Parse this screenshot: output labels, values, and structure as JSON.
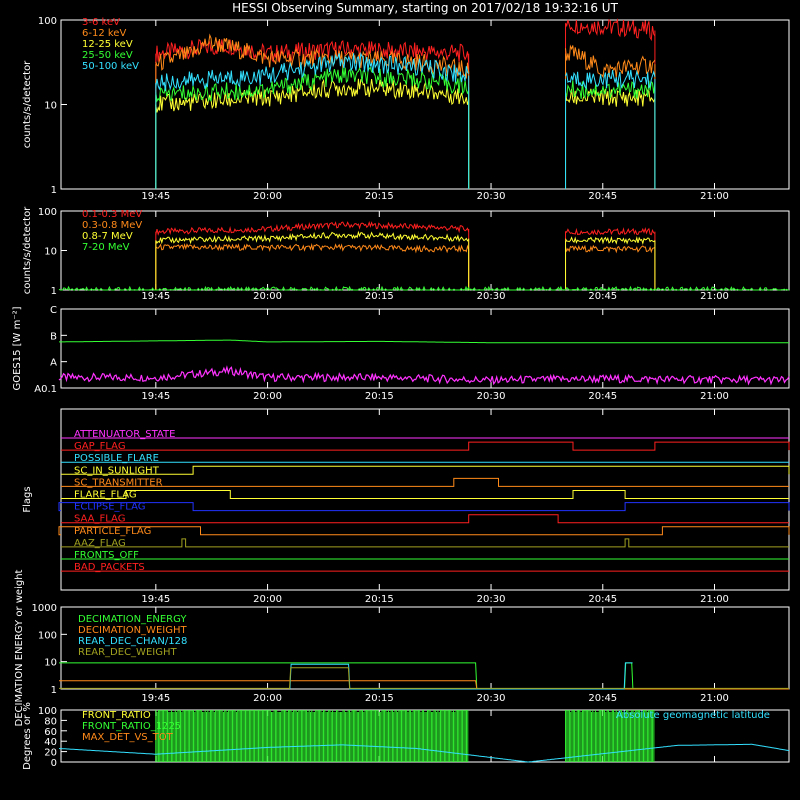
{
  "title": "HESSI Observing Summary, starting on 2017/02/18 19:32:16 UT",
  "time_ticks": [
    "19:45",
    "20:00",
    "20:15",
    "20:30",
    "20:45",
    "21:00"
  ],
  "colors": {
    "red": "#ff2020",
    "orange": "#ff8a1a",
    "yellow": "#ffff33",
    "green": "#33ff33",
    "cyan": "#33e0ff",
    "magenta": "#ff33ff",
    "blue": "#2233ff",
    "white": "#ffffff",
    "olive": "#a0a020",
    "lightgreen": "#aaff77"
  },
  "chart_data": [
    {
      "type": "line",
      "panel": "lightcurve",
      "ylabel": "counts/s/detector",
      "yscale": "log",
      "ylim": [
        1,
        100
      ],
      "ytick_labels": [
        "1",
        "10",
        "100"
      ],
      "legend_position": "top-left",
      "series": [
        {
          "name": "3-6 keV",
          "color": "red",
          "segments": [
            {
              "x": [
                "19:45",
                "19:50",
                "19:55",
                "20:00",
                "20:10",
                "20:20",
                "20:27"
              ],
              "y": [
                40,
                45,
                50,
                40,
                45,
                42,
                40
              ]
            },
            {
              "x": [
                "20:40",
                "20:45",
                "20:48",
                "20:52"
              ],
              "y": [
                90,
                85,
                80,
                75
              ]
            }
          ]
        },
        {
          "name": "6-12 keV",
          "color": "orange",
          "segments": [
            {
              "x": [
                "19:45",
                "19:50",
                "19:52",
                "20:00",
                "20:10",
                "20:20",
                "20:27"
              ],
              "y": [
                30,
                40,
                55,
                35,
                35,
                32,
                25
              ]
            },
            {
              "x": [
                "20:40",
                "20:41",
                "20:45",
                "20:52"
              ],
              "y": [
                40,
                40,
                25,
                30
              ]
            }
          ]
        },
        {
          "name": "12-25 keV",
          "color": "yellow",
          "segments": [
            {
              "x": [
                "19:45",
                "20:00",
                "20:10",
                "20:20",
                "20:27"
              ],
              "y": [
                10,
                12,
                16,
                15,
                12
              ]
            },
            {
              "x": [
                "20:40",
                "20:52"
              ],
              "y": [
                12,
                12
              ]
            }
          ]
        },
        {
          "name": "25-50 keV",
          "color": "green",
          "segments": [
            {
              "x": [
                "19:45",
                "20:00",
                "20:10",
                "20:20",
                "20:27"
              ],
              "y": [
                13,
                15,
                22,
                20,
                16
              ]
            },
            {
              "x": [
                "20:40",
                "20:52"
              ],
              "y": [
                15,
                15
              ]
            }
          ]
        },
        {
          "name": "50-100 keV",
          "color": "cyan",
          "segments": [
            {
              "x": [
                "19:45",
                "20:00",
                "20:10",
                "20:20",
                "20:27"
              ],
              "y": [
                18,
                22,
                32,
                28,
                22
              ]
            },
            {
              "x": [
                "20:40",
                "20:52"
              ],
              "y": [
                20,
                20
              ]
            }
          ]
        }
      ]
    },
    {
      "type": "line",
      "panel": "lightcurve-high",
      "ylabel": "counts/s/detector",
      "yscale": "log",
      "ylim": [
        1,
        100
      ],
      "ytick_labels": [
        "1",
        "10",
        "100"
      ],
      "legend_position": "top-left",
      "series": [
        {
          "name": "0.1-0.3 MeV",
          "color": "red",
          "segments": [
            {
              "x": [
                "19:45",
                "20:00",
                "20:10",
                "20:20",
                "20:27"
              ],
              "y": [
                30,
                35,
                45,
                40,
                35
              ]
            },
            {
              "x": [
                "20:40",
                "20:52"
              ],
              "y": [
                30,
                30
              ]
            }
          ]
        },
        {
          "name": "0.3-0.8 MeV",
          "color": "orange",
          "segments": [
            {
              "x": [
                "19:45",
                "20:00",
                "20:10",
                "20:20",
                "20:27"
              ],
              "y": [
                12,
                12,
                12,
                11,
                11
              ]
            },
            {
              "x": [
                "20:40",
                "20:52"
              ],
              "y": [
                11,
                11
              ]
            }
          ]
        },
        {
          "name": "0.8-7 MeV",
          "color": "yellow",
          "segments": [
            {
              "x": [
                "19:45",
                "20:00",
                "20:10",
                "20:20",
                "20:27"
              ],
              "y": [
                18,
                20,
                25,
                22,
                20
              ]
            },
            {
              "x": [
                "20:40",
                "20:52"
              ],
              "y": [
                18,
                18
              ]
            }
          ]
        },
        {
          "name": "7-20 MeV",
          "color": "green",
          "segments": [
            {
              "x": [
                "19:32",
                "21:10"
              ],
              "y": [
                1,
                1
              ]
            }
          ]
        }
      ]
    },
    {
      "type": "line",
      "panel": "goes",
      "ylabel": "GOES15 [W m⁻²]",
      "ytick_labels": [
        "A0.1",
        "A",
        "B",
        "C"
      ],
      "ylevels": [
        0,
        1,
        2,
        3
      ],
      "series": [
        {
          "color": "green",
          "segments": [
            {
              "x": [
                "19:32",
                "19:55",
                "20:00",
                "20:15",
                "20:30",
                "20:45",
                "21:10"
              ],
              "y": [
                1.75,
                1.82,
                1.75,
                1.77,
                1.72,
                1.72,
                1.72
              ]
            }
          ]
        },
        {
          "color": "magenta",
          "segments": [
            {
              "x": [
                "19:32",
                "19:45",
                "19:55",
                "20:00",
                "20:15",
                "20:30",
                "20:45",
                "21:10"
              ],
              "y": [
                0.4,
                0.4,
                0.65,
                0.4,
                0.4,
                0.3,
                0.35,
                0.3
              ]
            }
          ]
        }
      ]
    },
    {
      "type": "line",
      "panel": "flags",
      "ylabel": "Flags",
      "flags": [
        {
          "name": "ATTENUATOR_STATE",
          "color": "magenta",
          "highs": []
        },
        {
          "name": "GAP_FLAG",
          "color": "red",
          "highs": [
            [
              "20:27",
              "20:41"
            ],
            [
              "20:52",
              "21:10"
            ]
          ]
        },
        {
          "name": "POSSIBLE_FLARE",
          "color": "cyan",
          "highs": []
        },
        {
          "name": "SC_IN_SUNLIGHT",
          "color": "yellow",
          "highs": [
            [
              "19:50",
              "21:10"
            ]
          ]
        },
        {
          "name": "SC_TRANSMITTER",
          "color": "orange",
          "highs": [
            [
              "20:25",
              "20:31"
            ]
          ]
        },
        {
          "name": "FLARE_FLAG",
          "color": "yellow",
          "highs": [
            [
              "19:41",
              "19:55"
            ],
            [
              "20:41",
              "20:48"
            ]
          ]
        },
        {
          "name": "ECLIPSE_FLAG",
          "color": "blue",
          "highs": [
            [
              "19:32",
              "19:50"
            ],
            [
              "20:48",
              "21:10"
            ]
          ]
        },
        {
          "name": "SAA_FLAG",
          "color": "red",
          "highs": [
            [
              "20:27",
              "20:39"
            ]
          ]
        },
        {
          "name": "PARTICLE_FLAG",
          "color": "orange",
          "highs": [
            [
              "19:32",
              "19:51"
            ],
            [
              "20:53",
              "21:10"
            ]
          ]
        },
        {
          "name": "AAZ_FLAG",
          "color": "olive",
          "highs": [
            [
              "19:48.5",
              "19:49"
            ],
            [
              "20:48",
              "20:48.5"
            ]
          ]
        },
        {
          "name": "FRONTS_OFF",
          "color": "green",
          "highs": []
        },
        {
          "name": "BAD_PACKETS",
          "color": "red",
          "highs": []
        }
      ]
    },
    {
      "type": "line",
      "panel": "decimation",
      "ylabel": "DECIMATION ENERGY or weight",
      "yscale": "log",
      "ylim": [
        1,
        1000
      ],
      "ytick_labels": [
        "1",
        "10",
        "100",
        "1000"
      ],
      "series": [
        {
          "name": "DECIMATION_ENERGY",
          "color": "green",
          "segments": [
            {
              "x": [
                "19:32",
                "20:28",
                "20:28",
                "20:48",
                "20:48",
                "20:49",
                "20:49",
                "21:10"
              ],
              "y": [
                9,
                9,
                1,
                1,
                9,
                9,
                1,
                1
              ]
            }
          ]
        },
        {
          "name": "DECIMATION_WEIGHT",
          "color": "orange",
          "segments": [
            {
              "x": [
                "19:32",
                "20:28",
                "20:28",
                "21:10"
              ],
              "y": [
                2,
                2,
                1,
                1
              ]
            }
          ]
        },
        {
          "name": "REAR_DEC_CHAN/128",
          "color": "cyan",
          "segments": [
            {
              "x": [
                "20:03",
                "20:03",
                "20:11",
                "20:11",
                "20:48",
                "20:48",
                "20:49",
                "20:49"
              ],
              "y": [
                1,
                8,
                8,
                1,
                1,
                9,
                9,
                1
              ]
            }
          ]
        },
        {
          "name": "REAR_DEC_WEIGHT",
          "color": "olive",
          "segments": [
            {
              "x": [
                "19:32",
                "20:03",
                "20:03",
                "20:11",
                "20:11",
                "21:10"
              ],
              "y": [
                1.05,
                1.05,
                6,
                6,
                1.05,
                1.05
              ]
            }
          ]
        }
      ]
    },
    {
      "type": "line",
      "panel": "ratios",
      "ylabel": "Degrees or %",
      "ylim": [
        0,
        100
      ],
      "ytick_labels": [
        "0",
        "20",
        "40",
        "60",
        "80",
        "100"
      ],
      "legend_position": "top-left",
      "annotation": "Absolute geomagnetic latitude",
      "series": [
        {
          "name": "FRONT_RATIO",
          "color": "yellow",
          "segments": []
        },
        {
          "name": "FRONT_RATIO_1225",
          "color": "green",
          "segments": [
            {
              "x": [
                "19:45",
                "20:27"
              ],
              "y": [
                100,
                100
              ]
            },
            {
              "x": [
                "20:40",
                "20:52"
              ],
              "y": [
                100,
                100
              ]
            }
          ]
        },
        {
          "name": "MAX_DET_VS_TOT",
          "color": "orange",
          "segments": []
        },
        {
          "name": "Absolute geomagnetic latitude",
          "color": "cyan",
          "segments": [
            {
              "x": [
                "19:32",
                "19:45",
                "20:00",
                "20:10",
                "20:20",
                "20:35",
                "20:40",
                "20:55",
                "21:05",
                "21:10"
              ],
              "y": [
                26,
                15,
                28,
                33,
                26,
                0,
                8,
                32,
                34,
                22
              ]
            }
          ]
        }
      ]
    }
  ]
}
